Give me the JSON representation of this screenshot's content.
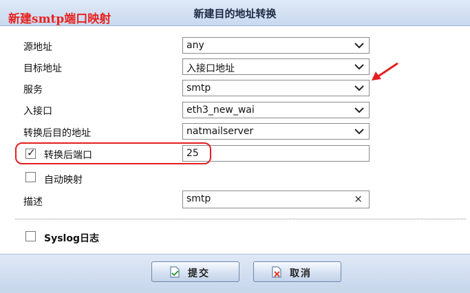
{
  "annotation": {
    "title": "新建smtp端口映射"
  },
  "window": {
    "title": "新建目的地址转换"
  },
  "form": {
    "source_address": {
      "label": "源地址",
      "value": "any"
    },
    "dest_address": {
      "label": "目标地址",
      "value": "入接口地址"
    },
    "service": {
      "label": "服务",
      "value": "smtp"
    },
    "in_interface": {
      "label": "入接口",
      "value": "eth3_new_wai"
    },
    "translated_dest": {
      "label": "转换后目的地址",
      "value": "natmailserver"
    },
    "translated_port": {
      "label": "转换后端口",
      "value": "25",
      "checked": true
    },
    "auto_map": {
      "label": "自动映射",
      "checked": false
    },
    "description": {
      "label": "描述",
      "value": "smtp"
    },
    "syslog": {
      "label": "Syslog日志",
      "checked": false
    }
  },
  "buttons": {
    "submit": "提交",
    "cancel": "取消"
  },
  "colors": {
    "annotation": "#e41e1e",
    "header": "#c9d9ef"
  }
}
